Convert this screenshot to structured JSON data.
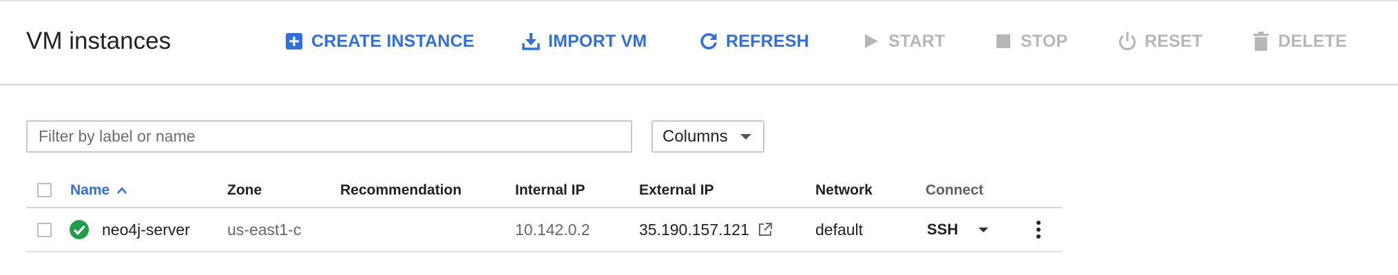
{
  "header": {
    "title": "VM instances"
  },
  "toolbar": {
    "create_instance": {
      "label": "CREATE INSTANCE",
      "icon": "add-box-icon",
      "enabled": true
    },
    "import_vm": {
      "label": "IMPORT VM",
      "icon": "download-icon",
      "enabled": true
    },
    "refresh": {
      "label": "REFRESH",
      "icon": "refresh-icon",
      "enabled": true
    },
    "start": {
      "label": "START",
      "icon": "play-icon",
      "enabled": false
    },
    "stop": {
      "label": "STOP",
      "icon": "stop-icon",
      "enabled": false
    },
    "reset": {
      "label": "RESET",
      "icon": "power-icon",
      "enabled": false
    },
    "delete": {
      "label": "DELETE",
      "icon": "trash-icon",
      "enabled": false
    }
  },
  "filter": {
    "placeholder": "Filter by label or name",
    "value": ""
  },
  "columns_button": {
    "label": "Columns"
  },
  "table": {
    "headers": {
      "name": "Name",
      "zone": "Zone",
      "recommendation": "Recommendation",
      "internal_ip": "Internal IP",
      "external_ip": "External IP",
      "network": "Network",
      "connect": "Connect"
    },
    "sort": {
      "column": "name",
      "direction": "ascending"
    },
    "rows": [
      {
        "status": "running",
        "name": "neo4j-server",
        "zone": "us-east1-c",
        "recommendation": "",
        "internal_ip": "10.142.0.2",
        "external_ip": "35.190.157.121",
        "network": "default",
        "connect": "SSH"
      }
    ]
  },
  "colors": {
    "accent": "#2f6fdf",
    "disabled": "#b7b7b7",
    "status_ok": "#1e9e4a"
  }
}
